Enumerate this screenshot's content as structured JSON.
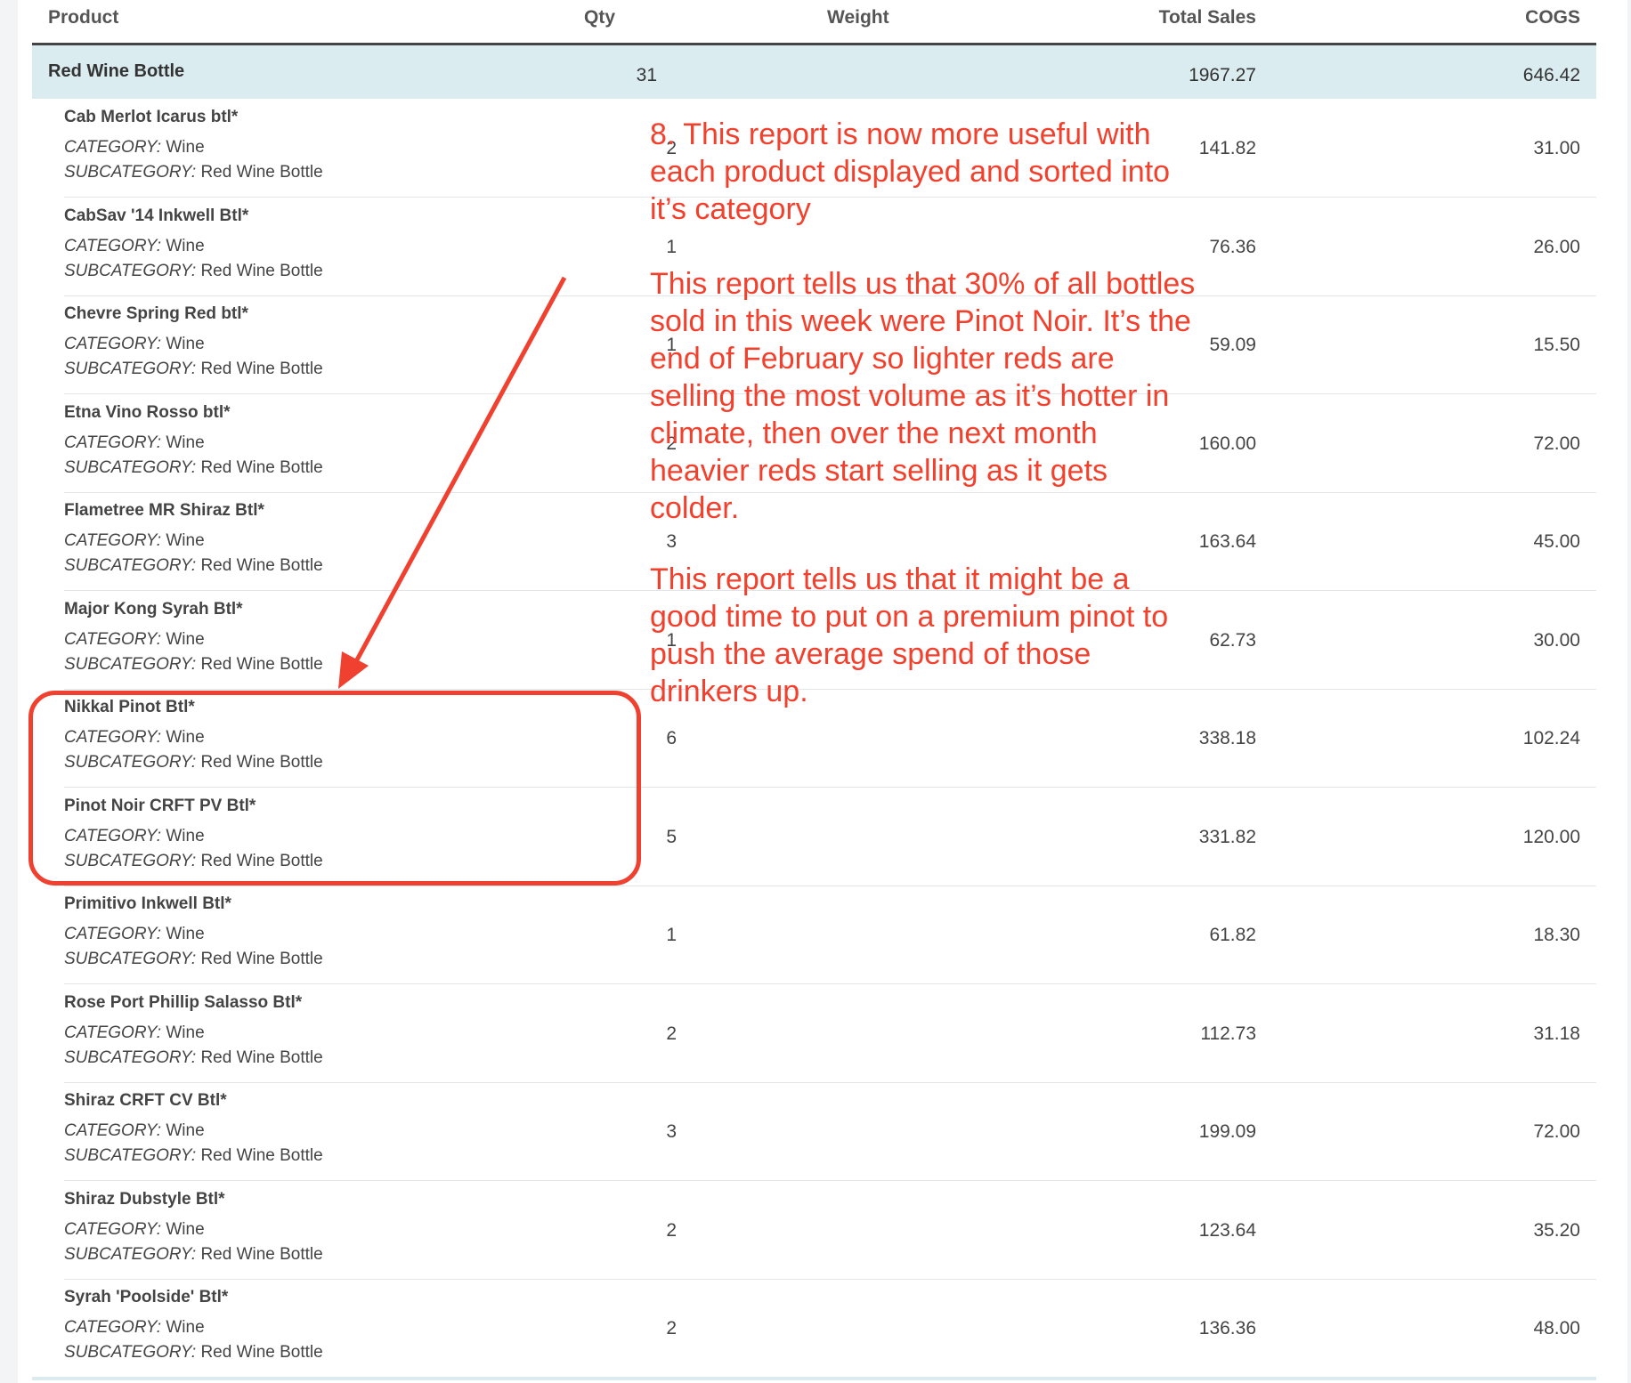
{
  "columns": {
    "product": "Product",
    "qty": "Qty",
    "weight": "Weight",
    "total_sales": "Total Sales",
    "cogs": "COGS"
  },
  "summary": {
    "name": "Red Wine Bottle",
    "qty": "31",
    "total_sales": "1967.27",
    "cogs": "646.42"
  },
  "meta_labels": {
    "category_label": "CATEGORY:",
    "subcategory_label": "SUBCATEGORY:"
  },
  "rows": [
    {
      "name": "Cab Merlot Icarus btl*",
      "category": "Wine",
      "subcategory": "Red Wine Bottle",
      "qty": "2",
      "total_sales": "141.82",
      "cogs": "31.00"
    },
    {
      "name": "CabSav '14 Inkwell Btl*",
      "category": "Wine",
      "subcategory": "Red Wine Bottle",
      "qty": "1",
      "total_sales": "76.36",
      "cogs": "26.00"
    },
    {
      "name": "Chevre Spring Red btl*",
      "category": "Wine",
      "subcategory": "Red Wine Bottle",
      "qty": "1",
      "total_sales": "59.09",
      "cogs": "15.50"
    },
    {
      "name": "Etna Vino Rosso btl*",
      "category": "Wine",
      "subcategory": "Red Wine Bottle",
      "qty": "2",
      "total_sales": "160.00",
      "cogs": "72.00"
    },
    {
      "name": "Flametree MR Shiraz Btl*",
      "category": "Wine",
      "subcategory": "Red Wine Bottle",
      "qty": "3",
      "total_sales": "163.64",
      "cogs": "45.00"
    },
    {
      "name": "Major Kong Syrah Btl*",
      "category": "Wine",
      "subcategory": "Red Wine Bottle",
      "qty": "1",
      "total_sales": "62.73",
      "cogs": "30.00"
    },
    {
      "name": "Nikkal Pinot Btl*",
      "category": "Wine",
      "subcategory": "Red Wine Bottle",
      "qty": "6",
      "total_sales": "338.18",
      "cogs": "102.24"
    },
    {
      "name": "Pinot Noir CRFT PV Btl*",
      "category": "Wine",
      "subcategory": "Red Wine Bottle",
      "qty": "5",
      "total_sales": "331.82",
      "cogs": "120.00"
    },
    {
      "name": "Primitivo Inkwell Btl*",
      "category": "Wine",
      "subcategory": "Red Wine Bottle",
      "qty": "1",
      "total_sales": "61.82",
      "cogs": "18.30"
    },
    {
      "name": "Rose Port Phillip Salasso Btl*",
      "category": "Wine",
      "subcategory": "Red Wine Bottle",
      "qty": "2",
      "total_sales": "112.73",
      "cogs": "31.18"
    },
    {
      "name": "Shiraz CRFT CV Btl*",
      "category": "Wine",
      "subcategory": "Red Wine Bottle",
      "qty": "3",
      "total_sales": "199.09",
      "cogs": "72.00"
    },
    {
      "name": "Shiraz Dubstyle Btl*",
      "category": "Wine",
      "subcategory": "Red Wine Bottle",
      "qty": "2",
      "total_sales": "123.64",
      "cogs": "35.20"
    },
    {
      "name": "Syrah 'Poolside' Btl*",
      "category": "Wine",
      "subcategory": "Red Wine Bottle",
      "qty": "2",
      "total_sales": "136.36",
      "cogs": "48.00"
    }
  ],
  "annotation": {
    "para1": "8. This report is now more useful with each product displayed and sorted into it’s category",
    "para2": "This report tells us that 30% of all bottles sold in this week were Pinot Noir.  It’s the end of February so lighter reds are selling the most volume as it’s hotter in climate, then over the next month heavier reds start selling as it gets colder.",
    "para3": "This report tells us that it might be a good time to put on a premium pinot to push the average spend of those drinkers up.",
    "color": "#f2402d"
  }
}
